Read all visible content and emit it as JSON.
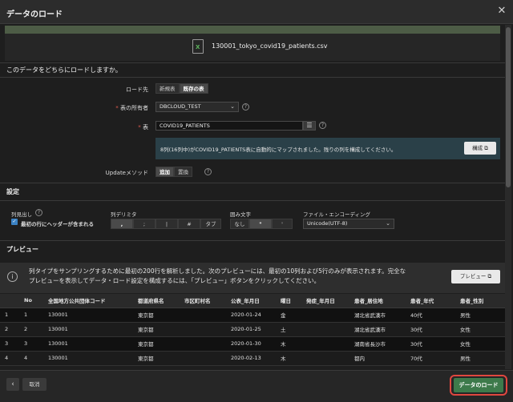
{
  "window": {
    "title": "データのロード"
  },
  "file": {
    "name": "130001_tokyo_covid19_patients.csv",
    "icon": "excel-file-icon"
  },
  "target": {
    "question": "このデータをどちらにロードしますか。",
    "load_dest_label": "ロード先",
    "load_dest_options": [
      "新規表",
      "既存の表"
    ],
    "owner_label": "表の所有者",
    "owner_value": "DBCLOUD_TEST",
    "table_label": "表",
    "table_value": "COVID19_PATIENTS",
    "info_text": "8列(16列中)がCOVID19_PATIENTS表に自動的にマップされました。残りの列を構成してください。",
    "configure_label": "構成",
    "update_method_label": "Updateメソッド",
    "update_method_options": [
      "追加",
      "置換"
    ]
  },
  "settings": {
    "title": "設定",
    "header_label": "列見出し",
    "header_checkbox_label": "最初の行にヘッダーが含まれる",
    "delimiter_label": "列デリミタ",
    "delimiter_options": [
      ",",
      ";",
      "|",
      "#",
      "タブ"
    ],
    "enclosure_label": "囲み文字",
    "enclosure_options": [
      "なし",
      "\"",
      "'"
    ],
    "encoding_label": "ファイル・エンコーディング",
    "encoding_value": "Unicode(UTF-8)"
  },
  "preview": {
    "title": "プレビュー",
    "info_line1": "列タイプをサンプリングするために最初の200行を解析しました。次のプレビューには、最初の10列および5行のみが表示されます。完全な",
    "info_line2": "プレビューを表示してデータ・ロード設定を構成するには、「プレビュー」ボタンをクリックしてください。",
    "button_label": "プレビュー",
    "columns": [
      "",
      "No",
      "全国地方公共団体コード",
      "都道府県名",
      "市区町村名",
      "公表_年月日",
      "曜日",
      "発症_年月日",
      "患者_居住地",
      "患者_年代",
      "患者_性別"
    ],
    "rows": [
      [
        "1",
        "1",
        "130001",
        "東京都",
        "",
        "2020-01-24",
        "金",
        "",
        "湖北省武漢市",
        "40代",
        "男性"
      ],
      [
        "2",
        "2",
        "130001",
        "東京都",
        "",
        "2020-01-25",
        "土",
        "",
        "湖北省武漢市",
        "30代",
        "女性"
      ],
      [
        "3",
        "3",
        "130001",
        "東京都",
        "",
        "2020-01-30",
        "木",
        "",
        "湖南省長沙市",
        "30代",
        "女性"
      ],
      [
        "4",
        "4",
        "130001",
        "東京都",
        "",
        "2020-02-13",
        "木",
        "",
        "都内",
        "70代",
        "男性"
      ]
    ]
  },
  "footer": {
    "back_icon": "chevron-left-icon",
    "cancel_label": "取消",
    "load_label": "データのロード"
  },
  "colors": {
    "accent_green": "#3d7a4b",
    "highlight_red": "#e0473f",
    "info_bg": "#2a4048"
  }
}
